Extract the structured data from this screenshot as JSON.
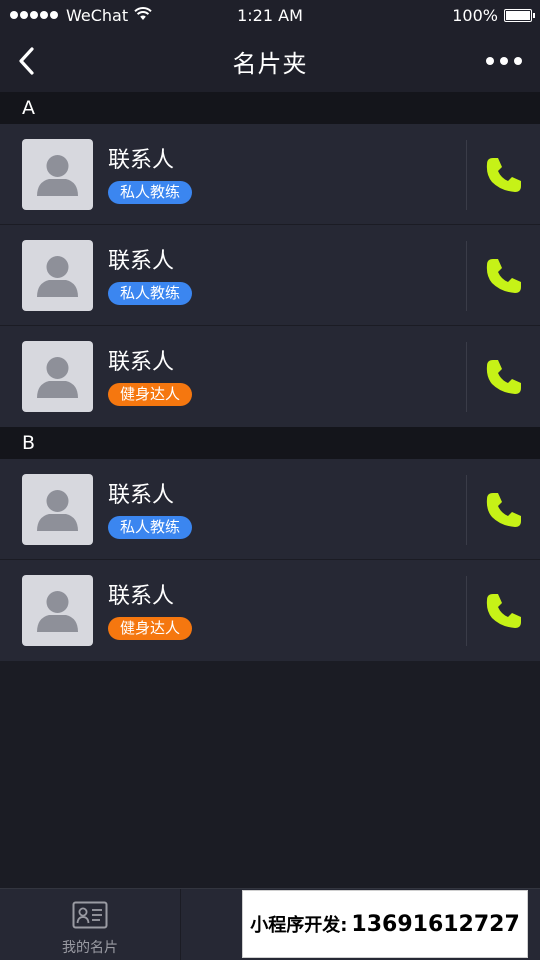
{
  "status_bar": {
    "carrier": "WeChat",
    "time": "1:21 AM",
    "battery": "100%"
  },
  "nav": {
    "title": "名片夹",
    "back_icon": "chevron-left-icon",
    "more_icon": "more-dots-icon"
  },
  "sections": [
    {
      "letter": "A",
      "contacts": [
        {
          "name": "联系人",
          "tag": "私人教练",
          "tag_color": "#3b86f0"
        },
        {
          "name": "联系人",
          "tag": "私人教练",
          "tag_color": "#3b86f0"
        },
        {
          "name": "联系人",
          "tag": "健身达人",
          "tag_color": "#f5770f"
        }
      ]
    },
    {
      "letter": "B",
      "contacts": [
        {
          "name": "联系人",
          "tag": "私人教练",
          "tag_color": "#3b86f0"
        },
        {
          "name": "联系人",
          "tag": "健身达人",
          "tag_color": "#f5770f"
        }
      ]
    }
  ],
  "tab_bar": {
    "tabs": [
      {
        "label": "我的名片",
        "icon": "business-card-icon"
      }
    ]
  },
  "promo": {
    "label": "小程序开发:",
    "number": "13691612727"
  },
  "colors": {
    "background": "#1b1c24",
    "row_background": "#262834",
    "section_header": "#14151b",
    "phone_icon": "#c6f217",
    "tag_blue": "#3b86f0",
    "tag_orange": "#f5770f"
  }
}
